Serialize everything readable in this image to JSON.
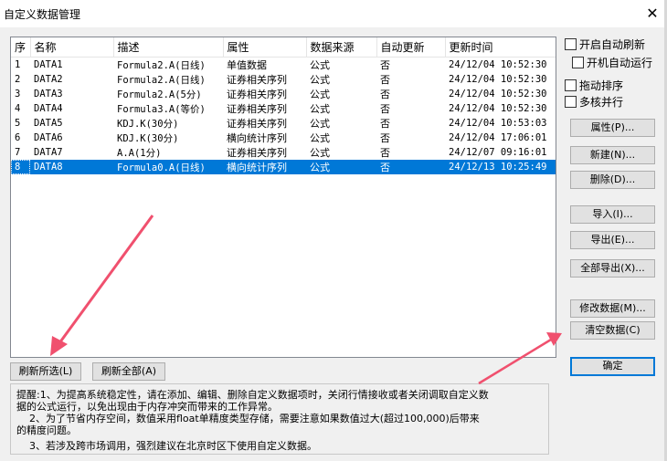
{
  "window": {
    "title": "自定义数据管理",
    "close_label": "✕"
  },
  "table": {
    "columns": [
      "序",
      "名称",
      "描述",
      "属性",
      "数据来源",
      "自动更新",
      "更新时间"
    ],
    "rows": [
      [
        "1",
        "DATA1",
        "Formula2.A(日线)",
        "单值数据",
        "公式",
        "否",
        "24/12/04 10:52:30"
      ],
      [
        "2",
        "DATA2",
        "Formula2.A(日线)",
        "证券相关序列",
        "公式",
        "否",
        "24/12/04 10:52:30"
      ],
      [
        "3",
        "DATA3",
        "Formula2.A(5分)",
        "证券相关序列",
        "公式",
        "否",
        "24/12/04 10:52:30"
      ],
      [
        "4",
        "DATA4",
        "Formula3.A(等价)",
        "证券相关序列",
        "公式",
        "否",
        "24/12/04 10:52:30"
      ],
      [
        "5",
        "DATA5",
        "KDJ.K(30分)",
        "证券相关序列",
        "公式",
        "否",
        "24/12/04 10:53:03"
      ],
      [
        "6",
        "DATA6",
        "KDJ.K(30分)",
        "横向统计序列",
        "公式",
        "否",
        "24/12/04 17:06:01"
      ],
      [
        "7",
        "DATA7",
        "A.A(1分)",
        "证券相关序列",
        "公式",
        "否",
        "24/12/07 09:16:01"
      ],
      [
        "8",
        "DATA8",
        "Formula0.A(日线)",
        "横向统计序列",
        "公式",
        "否",
        "24/12/13 10:25:49"
      ]
    ],
    "selected_row": "8"
  },
  "options": {
    "auto_refresh": "开启自动刷新",
    "boot_auto_run": "开机自动运行",
    "drag_sort": "拖动排序",
    "multicore": "多核并行"
  },
  "buttons": {
    "properties": "属性(P)...",
    "new": "新建(N)...",
    "delete": "删除(D)...",
    "import": "导入(I)...",
    "export": "导出(E)...",
    "export_all": "全部导出(X)...",
    "modify_data": "修改数据(M)...",
    "clear_data": "清空数据(C)",
    "ok": "确定",
    "refresh_selected": "刷新所选(L)",
    "refresh_all": "刷新全部(A)"
  },
  "tips": {
    "line1": "提醒:1、为提高系统稳定性，请在添加、编辑、删除自定义数据项时，关闭行情接收或者关闭调取自定义数",
    "line2": "据的公式运行，以免出现由于内存冲突而带来的工作异常。",
    "line3": "2、为了节省内存空间，数值采用float单精度类型存储，需要注意如果数值过大(超过100,000)后带来",
    "line4": "的精度问题。",
    "line5": "3、若涉及跨市场调用，强烈建议在北京时区下使用自定义数据。"
  },
  "colors": {
    "selection": "#0078d7",
    "annotation_arrow": "#f0506e"
  }
}
